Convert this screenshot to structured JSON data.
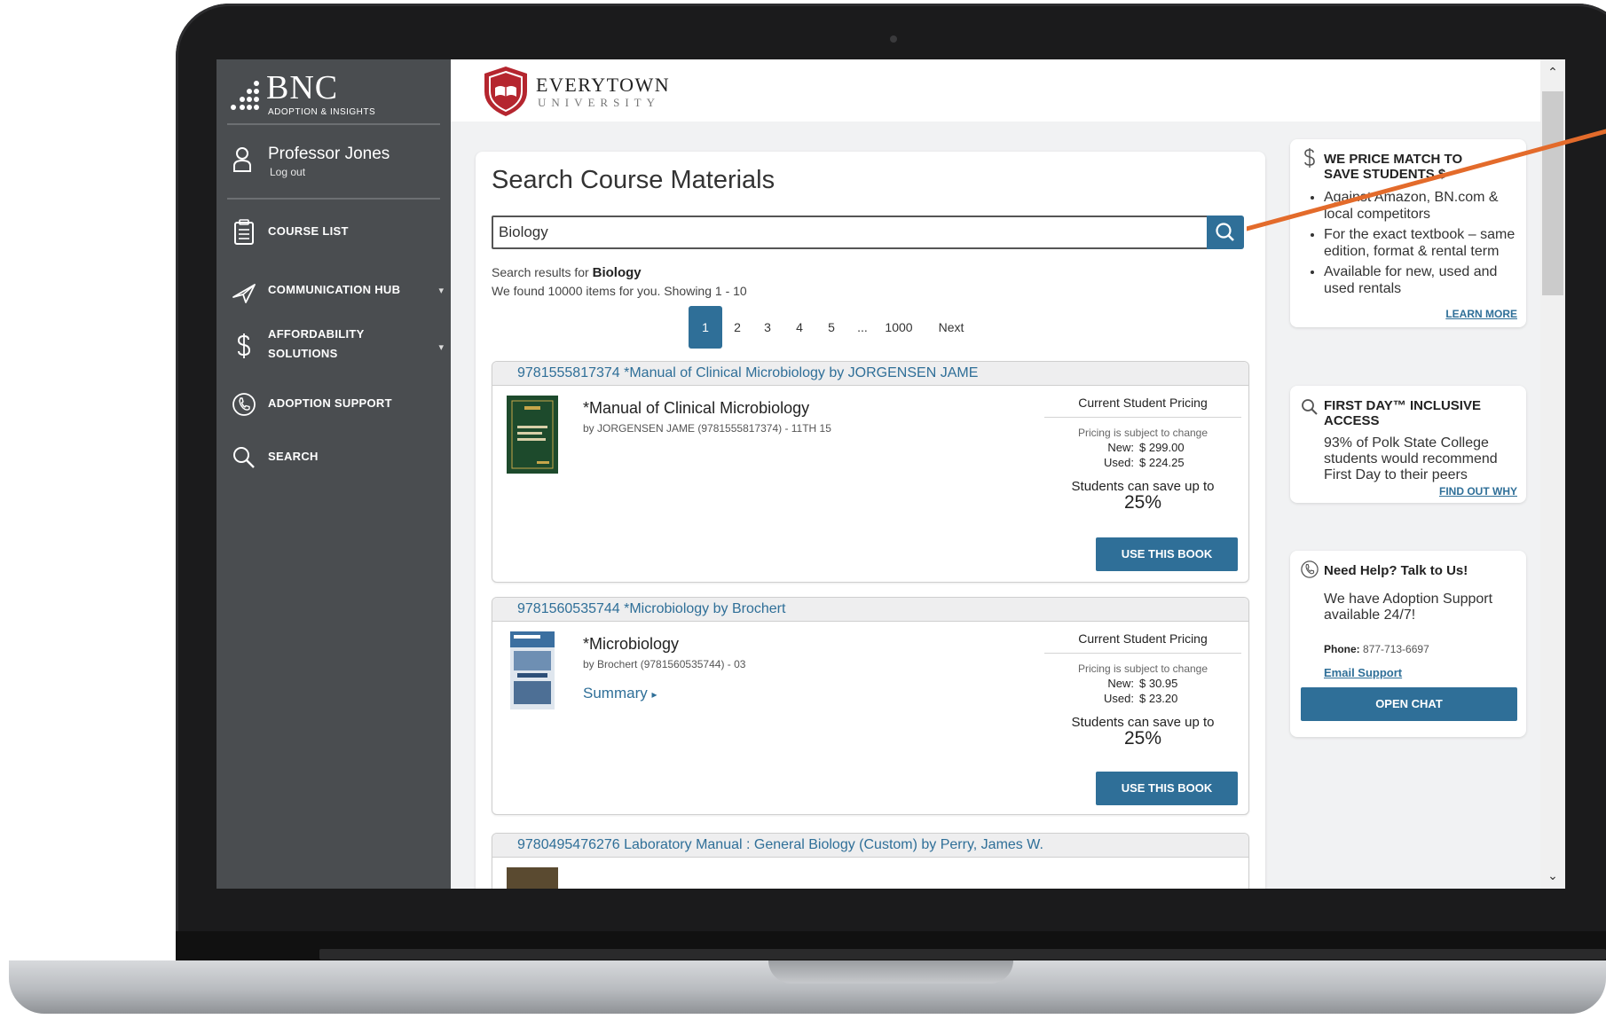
{
  "sidebar": {
    "logo_main": "BNC",
    "logo_sub": "ADOPTION & INSIGHTS",
    "collapse_glyph": "‹",
    "user_name": "Professor Jones",
    "logout": "Log out",
    "items": [
      {
        "label": "COURSE LIST",
        "icon": "clipboard-list-icon",
        "caret": ""
      },
      {
        "label": "COMMUNICATION HUB",
        "icon": "paper-plane-icon",
        "caret": "▾"
      },
      {
        "label": "AFFORDABILITY",
        "label2": "SOLUTIONS",
        "icon": "dollar-icon",
        "caret": "▾"
      },
      {
        "label": "ADOPTION SUPPORT",
        "icon": "phone-icon",
        "caret": ""
      },
      {
        "label": "SEARCH",
        "icon": "search-icon",
        "caret": ""
      }
    ]
  },
  "header": {
    "university_name": "EVERYTOWN",
    "university_sub": "UNIVERSITY"
  },
  "main": {
    "title": "Search Course Materials",
    "search_value": "Biology",
    "results_prefix": "Search results for ",
    "results_term": "Biology",
    "results_count": "We found 10000 items for you. Showing 1 - 10",
    "pages": [
      "1",
      "2",
      "3",
      "4",
      "5",
      "...",
      "1000",
      "Next"
    ],
    "active_page": "1"
  },
  "results": [
    {
      "header": "9781555817374 *Manual of Clinical Microbiology by JORGENSEN JAME",
      "title": "*Manual of Clinical Microbiology",
      "byline": "by JORGENSEN JAME (9781555817374) - 11TH 15",
      "summary": "",
      "pricing_title": "Current Student Pricing",
      "pricing_note": "Pricing is subject to change",
      "new_label": "New:",
      "new_price": "$ 299.00",
      "used_label": "Used:",
      "used_price": "$ 224.25",
      "save_text": "Students can save up to",
      "save_pct": "25%",
      "button": "USE THIS BOOK",
      "cover_color": "#1d4a2c"
    },
    {
      "header": "9781560535744 *Microbiology by Brochert",
      "title": "*Microbiology",
      "byline": "by Brochert (9781560535744) - 03",
      "summary": "Summary",
      "pricing_title": "Current Student Pricing",
      "pricing_note": "Pricing is subject to change",
      "new_label": "New:",
      "new_price": "$ 30.95",
      "used_label": "Used:",
      "used_price": "$ 23.20",
      "save_text": "Students can save up to",
      "save_pct": "25%",
      "button": "USE THIS BOOK",
      "cover_color": "#3b6fa0"
    },
    {
      "header": "9780495476276 Laboratory Manual : General Biology (Custom) by Perry, James W."
    }
  ],
  "widgets": {
    "price_match": {
      "icon": "dollar-icon",
      "title1": "WE PRICE MATCH TO",
      "title2": "SAVE STUDENTS $",
      "bullets": [
        "Against Amazon, BN.com & local competitors",
        "For the exact textbook – same edition, format & rental term",
        "Available for new, used and used rentals"
      ],
      "link": "LEARN MORE"
    },
    "first_day": {
      "icon": "search-icon",
      "title1": "FIRST DAY™ INCLUSIVE",
      "title2": "ACCESS",
      "text": "93% of Polk State College students would recommend First Day to their peers",
      "link": "FIND OUT WHY"
    },
    "help": {
      "icon": "phone-icon",
      "title": "Need Help? Talk to Us!",
      "text": "We have Adoption Support available 24/7!",
      "phone_label": "Phone:",
      "phone": "877-713-6697",
      "email_link": "Email Support",
      "button": "OPEN CHAT"
    }
  },
  "colors": {
    "sidebar": "#4a4d50",
    "accent": "#2f6f98",
    "annotation": "#e36b2b",
    "brand_red": "#b5262f"
  }
}
